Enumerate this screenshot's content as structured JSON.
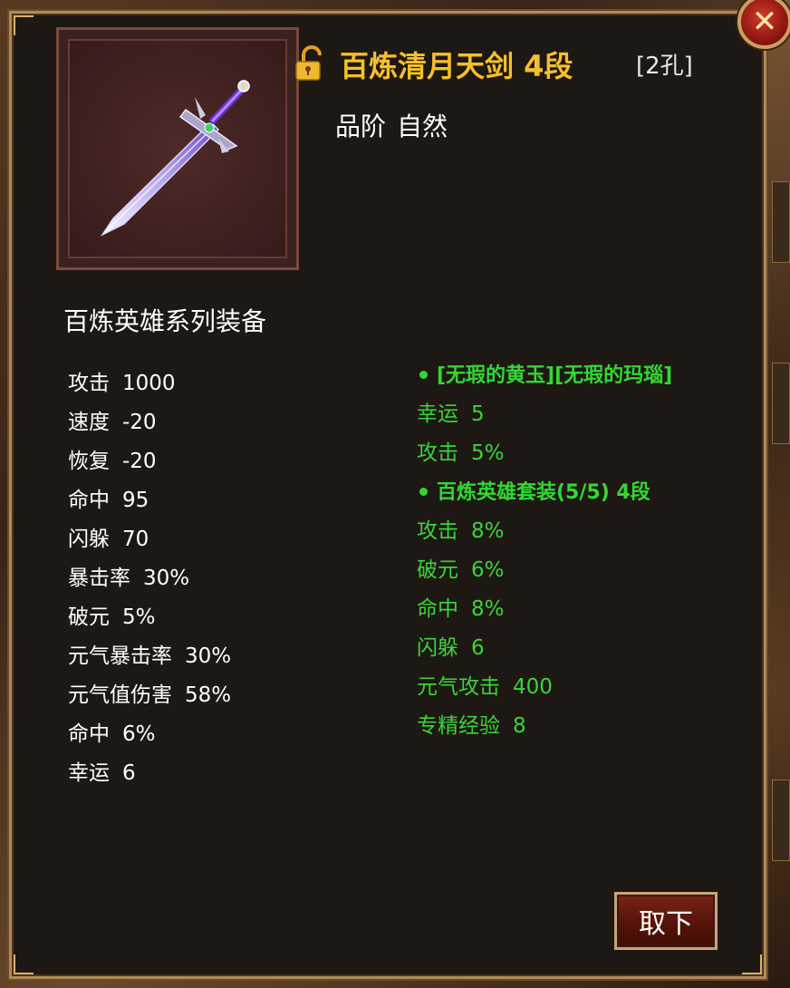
{
  "item": {
    "name": "百炼清月天剑 4段",
    "holes": "[2孔]",
    "grade_label": "品阶",
    "grade_value": "自然",
    "series": "百炼英雄系列装备",
    "icon": "sword-icon",
    "lock_icon": "unlocked-padlock-icon"
  },
  "base_stats": [
    {
      "name": "攻击",
      "value": "1000"
    },
    {
      "name": "速度",
      "value": "-20"
    },
    {
      "name": "恢复",
      "value": "-20"
    },
    {
      "name": "命中",
      "value": "95"
    },
    {
      "name": "闪躲",
      "value": "70"
    },
    {
      "name": "暴击率",
      "value": "30%"
    },
    {
      "name": "破元",
      "value": "5%"
    },
    {
      "name": "元气暴击率",
      "value": "30%"
    },
    {
      "name": "元气值伤害",
      "value": "58%"
    },
    {
      "name": "命中",
      "value": "6%"
    },
    {
      "name": "幸运",
      "value": "6"
    }
  ],
  "gems": {
    "header": "[无瑕的黄玉][无瑕的玛瑙]",
    "stats": [
      {
        "name": "幸运",
        "value": "5"
      },
      {
        "name": "攻击",
        "value": "5%"
      }
    ]
  },
  "set_bonus": {
    "header": "百炼英雄套装(5/5) 4段",
    "stats": [
      {
        "name": "攻击",
        "value": "8%"
      },
      {
        "name": "破元",
        "value": "6%"
      },
      {
        "name": "命中",
        "value": "8%"
      },
      {
        "name": "闪躲",
        "value": "6"
      },
      {
        "name": "元气攻击",
        "value": "400"
      },
      {
        "name": "专精经验",
        "value": "8"
      }
    ]
  },
  "buttons": {
    "close_icon": "close-icon",
    "unequip_label": "取下"
  },
  "colors": {
    "title": "#f5c028",
    "bonus_green": "#32d832",
    "panel_bg": "#1e1814",
    "frame_gold": "#b08a55"
  }
}
